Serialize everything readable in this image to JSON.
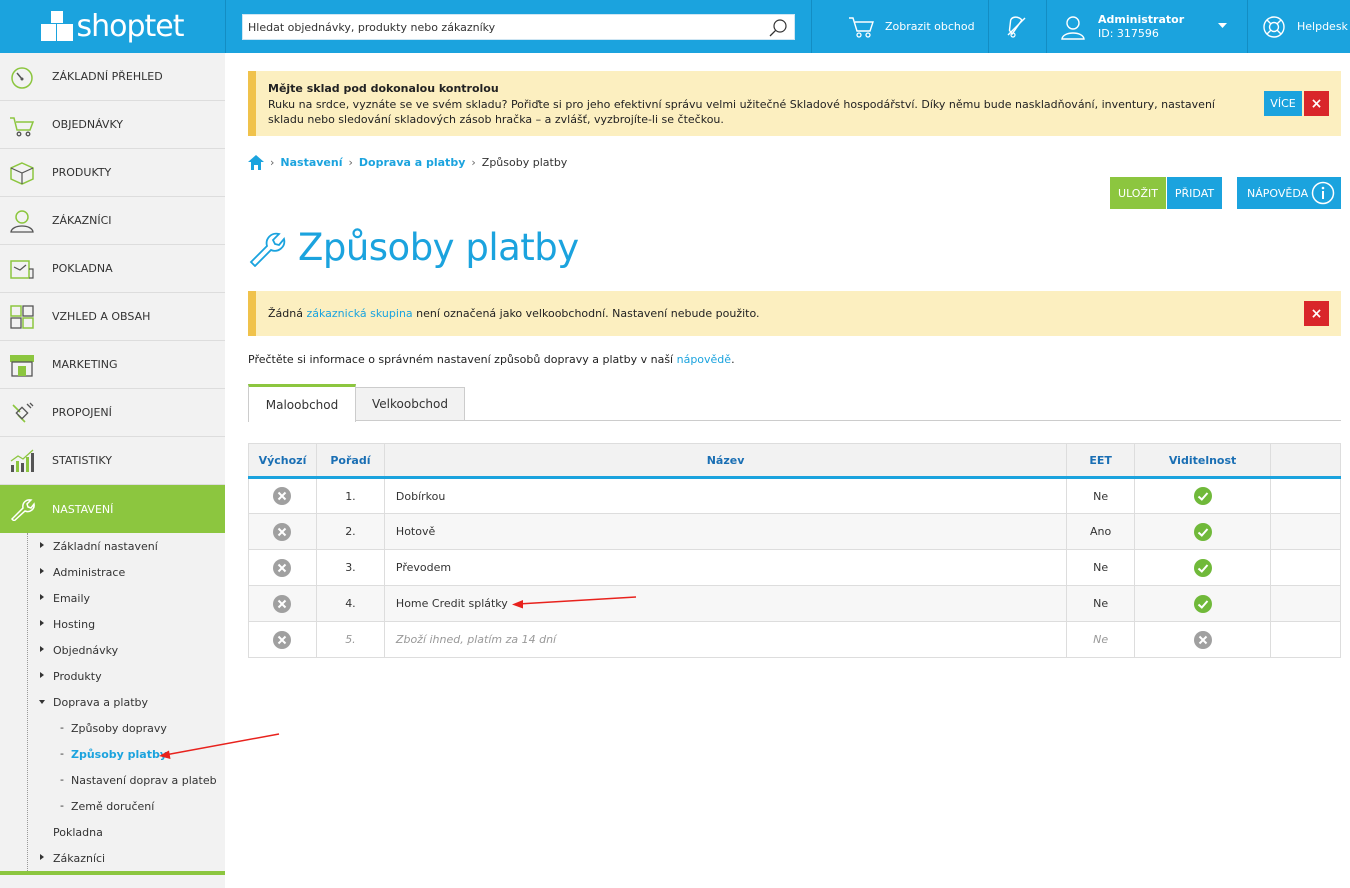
{
  "topbar": {
    "logo_text": "shoptet",
    "search_placeholder": "Hledat objednávky, produkty nebo zákazníky",
    "show_shop": "Zobrazit obchod",
    "admin_name": "Administrator",
    "admin_id": "ID: 317596",
    "helpdesk": "Helpdesk"
  },
  "sidebar": {
    "items": [
      {
        "label": "ZÁKLADNÍ PŘEHLED",
        "icon": "speedometer-icon"
      },
      {
        "label": "OBJEDNÁVKY",
        "icon": "cart-icon"
      },
      {
        "label": "PRODUKTY",
        "icon": "box-icon"
      },
      {
        "label": "ZÁKAZNÍCI",
        "icon": "user-icon"
      },
      {
        "label": "POKLADNA",
        "icon": "register-icon"
      },
      {
        "label": "VZHLED A OBSAH",
        "icon": "grid-icon"
      },
      {
        "label": "MARKETING",
        "icon": "store-icon"
      },
      {
        "label": "PROPOJENÍ",
        "icon": "plug-icon"
      },
      {
        "label": "STATISTIKY",
        "icon": "bar-chart-icon"
      },
      {
        "label": "NASTAVENÍ",
        "icon": "wrench-icon"
      }
    ],
    "subitems": [
      "Základní nastavení",
      "Administrace",
      "Emaily",
      "Hosting",
      "Objednávky",
      "Produkty",
      "Doprava a platby"
    ],
    "subsubitems": [
      "Způsoby dopravy",
      "Způsoby platby",
      "Nastavení doprav a plateb",
      "Země doručení"
    ],
    "after": [
      "Pokladna",
      "Zákazníci"
    ]
  },
  "promo": {
    "title": "Mějte sklad pod dokonalou kontrolou",
    "text": "Ruku na srdce, vyznáte se ve svém skladu? Pořiďte si pro jeho efektivní správu velmi užitečné Skladové hospodářství. Díky němu bude naskladňování, inventury, nastavení skladu nebo sledování skladových zásob hračka – a zvlášť, vyzbrojíte-li se čtečkou.",
    "more": "VÍCE",
    "close": "×"
  },
  "breadcrumb": {
    "sep": "›",
    "items": [
      "Nastavení",
      "Doprava a platby"
    ],
    "current": "Způsoby platby"
  },
  "toolbar": {
    "save": "ULOŽIT",
    "add": "PŘIDAT",
    "help": "NÁPOVĚDA"
  },
  "page_title": "Způsoby platby",
  "warning": {
    "prefix": "Žádná ",
    "link": "zákaznická skupina",
    "suffix": " není označená jako velkoobchodní. Nastavení nebude použito.",
    "close": "×"
  },
  "info": {
    "text": "Přečtěte si informace o správném nastavení způsobů dopravy a platby v naší ",
    "link": "nápovědě",
    "end": "."
  },
  "tabs": [
    "Maloobchod",
    "Velkoobchod"
  ],
  "table": {
    "headers": [
      "Výchozí",
      "Pořadí",
      "Název",
      "EET",
      "Viditelnost",
      ""
    ],
    "rows": [
      {
        "order": "1.",
        "name": "Dobírkou",
        "eet": "Ne",
        "visible": true
      },
      {
        "order": "2.",
        "name": "Hotově",
        "eet": "Ano",
        "visible": true
      },
      {
        "order": "3.",
        "name": "Převodem",
        "eet": "Ne",
        "visible": true
      },
      {
        "order": "4.",
        "name": "Home Credit splátky",
        "eet": "Ne",
        "visible": true
      },
      {
        "order": "5.",
        "name": "Zboží ihned, platím za 14 dní",
        "eet": "Ne",
        "visible": false
      }
    ]
  },
  "colors": {
    "brand_blue": "#1ba3de",
    "brand_green": "#8cc63f",
    "danger_red": "#d9262a",
    "alert_bg": "#fcefc0",
    "annotation_red": "#e8221d"
  }
}
